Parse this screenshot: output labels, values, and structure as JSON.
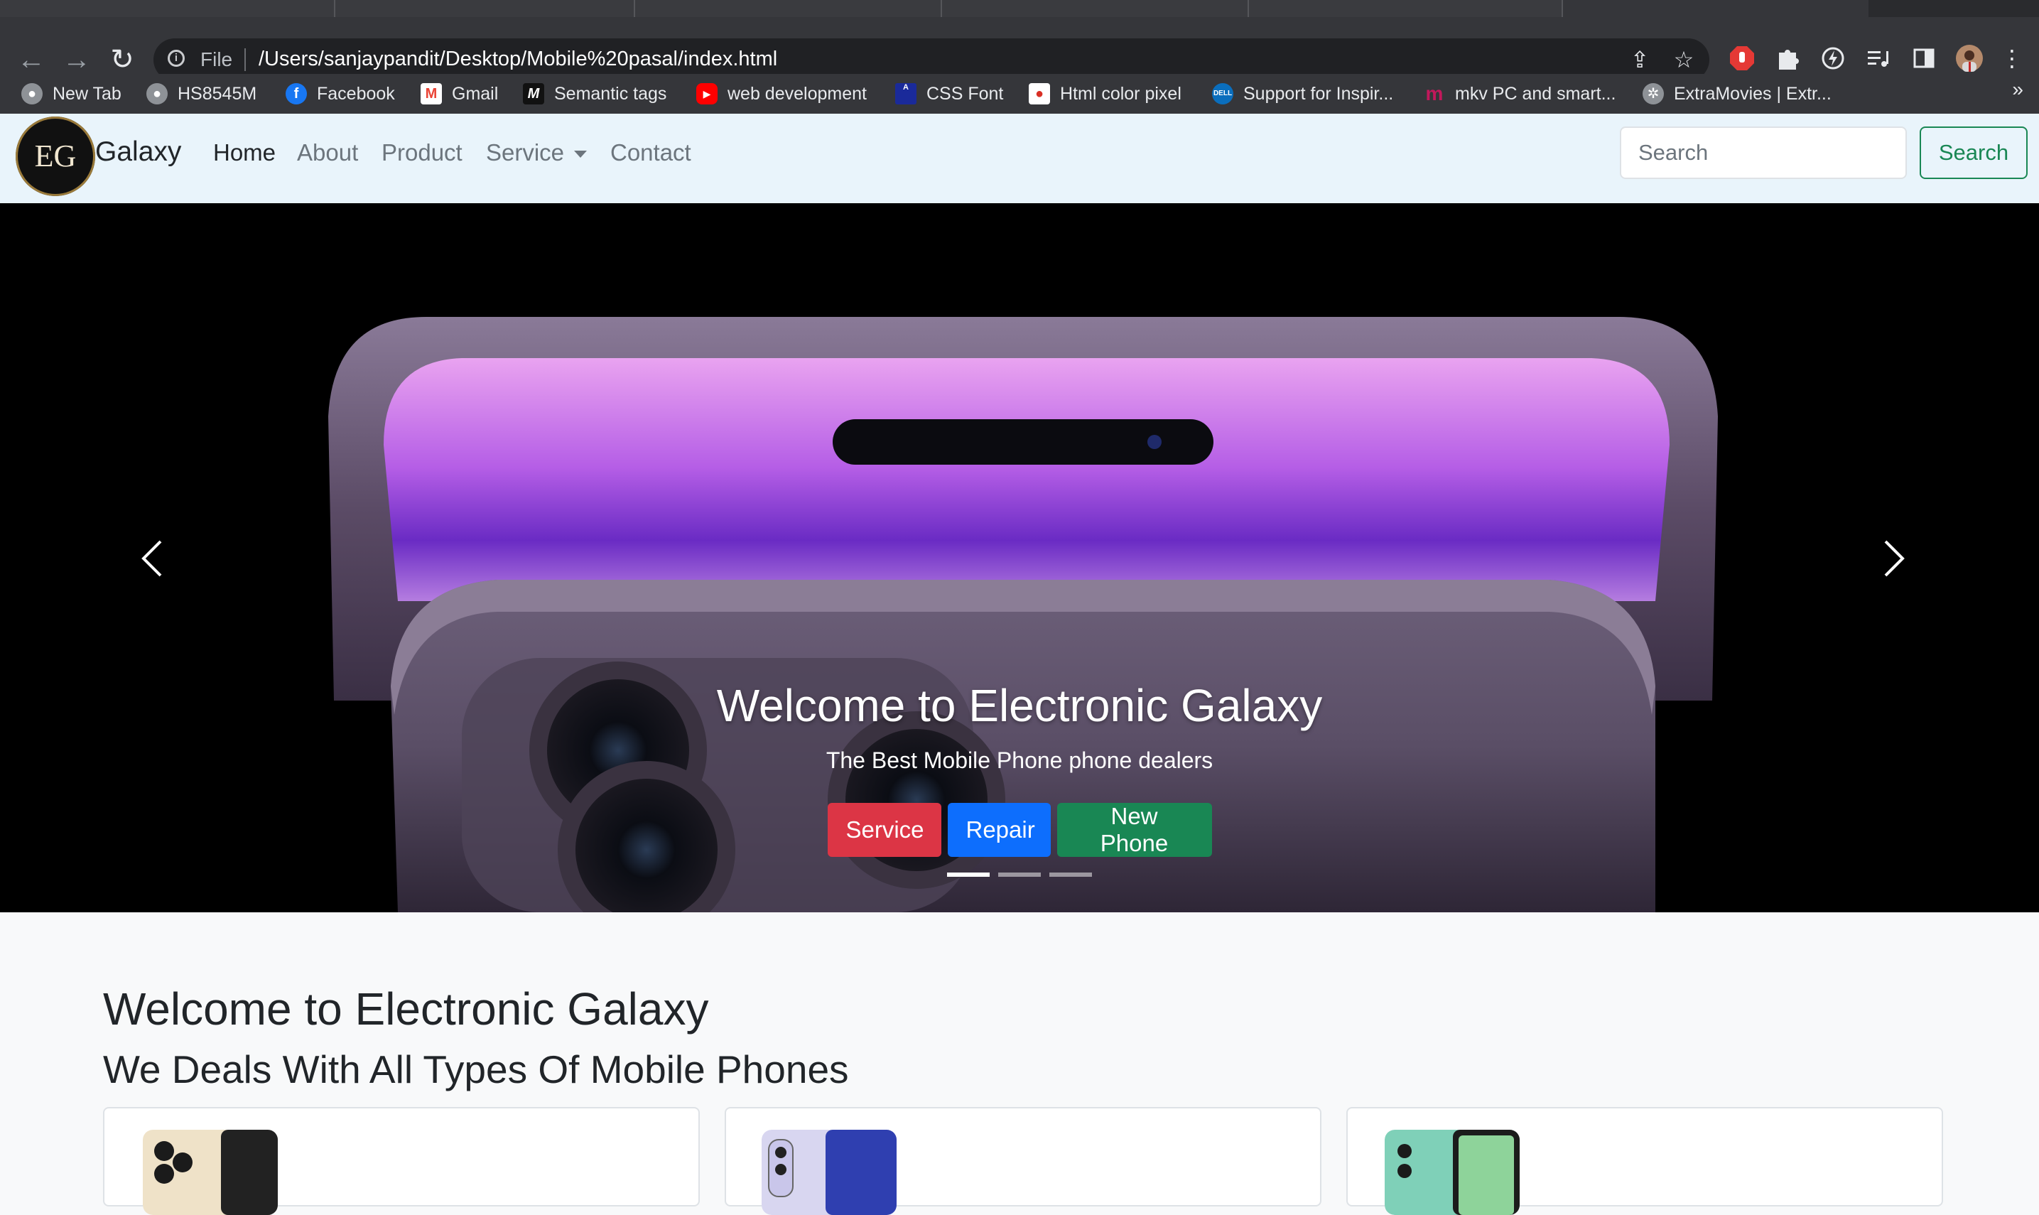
{
  "browser": {
    "file_label": "File",
    "url": "/Users/sanjaypandit/Desktop/Mobile%20pasal/index.html",
    "bookmarks": [
      {
        "label": "New Tab",
        "icon": "globe-icon",
        "color": "#8e9297"
      },
      {
        "label": "HS8545M",
        "icon": "globe-icon",
        "color": "#8e9297"
      },
      {
        "label": "Facebook",
        "icon": "facebook-icon",
        "color": "#1877f2"
      },
      {
        "label": "Gmail",
        "icon": "gmail-icon",
        "color": "#ea4335"
      },
      {
        "label": "Semantic tags",
        "icon": "m-icon",
        "color": "#111111"
      },
      {
        "label": "web development",
        "icon": "youtube-icon",
        "color": "#ff0000"
      },
      {
        "label": "CSS Font",
        "icon": "cssfont-icon",
        "color": "#1a2a9a"
      },
      {
        "label": "Html color pixel",
        "icon": "colorpixel-icon",
        "color": "#d93025"
      },
      {
        "label": "Support for Inspir...",
        "icon": "dell-icon",
        "color": "#0a6ebd"
      },
      {
        "label": "mkv PC and smart...",
        "icon": "mkv-icon",
        "color": "#c2185b"
      },
      {
        "label": "ExtraMovies | Extr...",
        "icon": "film-icon",
        "color": "#8e9297"
      }
    ],
    "more": "»"
  },
  "navbar": {
    "logo_text": "EG",
    "brand": "Galaxy",
    "links": [
      "Home",
      "About",
      "Product",
      "Service",
      "Contact"
    ],
    "search_placeholder": "Search",
    "search_button": "Search"
  },
  "carousel": {
    "title": "Welcome to Electronic Galaxy",
    "subtitle": "The Best Mobile Phone phone dealers",
    "buttons": [
      "Service",
      "Repair",
      "New Phone"
    ],
    "slide_count": 3,
    "active_slide": 1
  },
  "main": {
    "heading": "Welcome to Electronic Galaxy",
    "subheading": "We Deals With All Types Of Mobile Phones"
  },
  "colors": {
    "danger": "#dc3545",
    "primary": "#0d6efd",
    "success": "#198754",
    "navbar_bg": "#e9f4fb"
  }
}
